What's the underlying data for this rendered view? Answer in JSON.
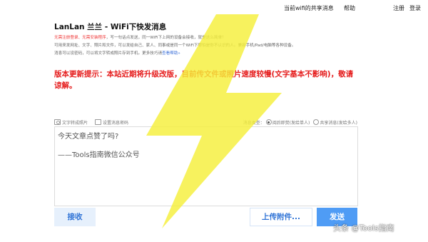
{
  "topnav": {
    "share": "当前wifi的共享消息",
    "help": "帮助",
    "register": "注册",
    "login": "登录"
  },
  "header": {
    "title": "LanLan 兰兰 - WiFi下快发消息"
  },
  "intro": {
    "red_text": "无需注册登录、无需安装程序",
    "line1_rest": "，写一句话点发送，同一WiFi下上网的设备会接收，就是这么简单！",
    "line2": "可用来发网址、文字、照片和文件，可以发给自己、家人、同事或是同一个WiFi下哪怕是你不认识的人。兼容手机/Pad/电脑等各种设备。",
    "line3_prefix": "消息可以设密码，可以将文字转成照片存到手机。更多技巧请",
    "help_link": "查看帮助»"
  },
  "notice": {
    "text": "版本更新提示：本站近期将升级改版，目前传文件或照片速度较慢(文字基本不影响)，敬请谅解。"
  },
  "options": {
    "text_to_photo": "文字转成照片",
    "set_password": "设置消息密码",
    "msg_type_label": "消息类型：",
    "type_direct": "阅后即焚(发给单人)",
    "type_shared": "共享消息(发给多人)"
  },
  "message": {
    "line1": "今天文章点赞了吗?",
    "line2": "——Tools指南微信公众号"
  },
  "buttons": {
    "receive": "接收",
    "upload": "上传附件...",
    "send": "发送"
  },
  "watermark": {
    "text": "头条 @Tools指南"
  },
  "colors": {
    "bolt": "#f5ef3a",
    "notice": "#e51c1c",
    "accent": "#2f73d6",
    "send_bg": "#4f9cf5",
    "receive_bg": "#e6f0fc"
  }
}
